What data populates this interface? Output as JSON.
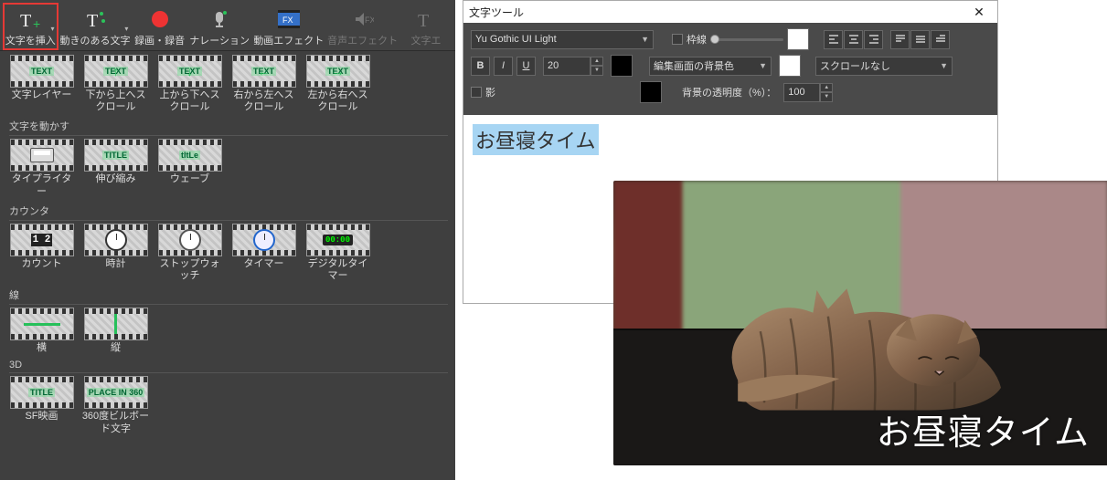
{
  "toolbar": {
    "items": [
      {
        "label": "文字を挿入",
        "dim": false,
        "sel": true
      },
      {
        "label": "動きのある文字",
        "dim": false
      },
      {
        "label": "録画・録音",
        "dim": false
      },
      {
        "label": "ナレーション",
        "dim": false
      },
      {
        "label": "動画エフェクト",
        "dim": false
      },
      {
        "label": "音声エフェクト",
        "dim": true
      },
      {
        "label": "文字エ",
        "dim": true
      }
    ]
  },
  "sections": {
    "row0": [
      {
        "label": "文字レイヤー",
        "inner": "TEXT"
      },
      {
        "label": "下から上へスクロール",
        "inner": "TEXT",
        "arrow": "↑"
      },
      {
        "label": "上から下へスクロール",
        "inner": "TEXT",
        "arrow": "↓"
      },
      {
        "label": "右から左へスクロール",
        "inner": "TEXT",
        "arrow": "←"
      },
      {
        "label": "左から右へスクロール",
        "inner": "TEXT",
        "arrow": "→"
      }
    ],
    "moveTitle": "文字を動かす",
    "move": [
      {
        "label": "タイプライター",
        "kind": "typewriter"
      },
      {
        "label": "伸び縮み",
        "inner": "TITLE"
      },
      {
        "label": "ウェーブ",
        "inner": "tItLe"
      }
    ],
    "counterTitle": "カウンタ",
    "counter": [
      {
        "label": "カウント",
        "kind": "count"
      },
      {
        "label": "時計",
        "kind": "clock"
      },
      {
        "label": "ストップウォッチ",
        "kind": "stopwatch"
      },
      {
        "label": "タイマー",
        "kind": "timer"
      },
      {
        "label": "デジタルタイマー",
        "kind": "digital"
      }
    ],
    "lineTitle": "線",
    "line": [
      {
        "label": "横",
        "kind": "hline"
      },
      {
        "label": "縦",
        "kind": "vline"
      }
    ],
    "threeDTitle": "3D",
    "threeD": [
      {
        "label": "SF映画",
        "inner": "TITLE"
      },
      {
        "label": "360度ビルボード文字",
        "inner": "PLACE IN 360"
      }
    ]
  },
  "textTool": {
    "title": "文字ツール",
    "font": "Yu Gothic UI Light",
    "bold": "B",
    "italic": "I",
    "underline": "U",
    "size": "20",
    "shadow": "影",
    "border": "枠線",
    "bgLabel": "編集画面の背景色",
    "opacityLabel": "背景の透明度（%）：",
    "opacity": "100",
    "scroll": "スクロールなし",
    "editText": "お昼寝タイム",
    "overlayText": "お昼寝タイム",
    "colors": {
      "text": "#000000",
      "shadow": "#000000",
      "border": "#ffffff",
      "bg": "#ffffff"
    }
  }
}
